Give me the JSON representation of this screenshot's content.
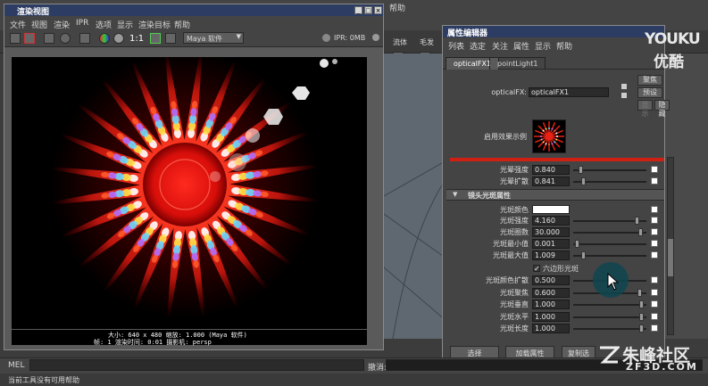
{
  "render_view": {
    "title": "渲染视图",
    "menu": [
      "文件",
      "视图",
      "渲染",
      "IPR",
      "选项",
      "显示",
      "渲染目标",
      "帮助"
    ],
    "renderer": "Maya 软件",
    "ratio_label": "1:1",
    "ipr_status": "IPR: 0MB",
    "info_line1": "大小: 640 x 480  缩放: 1.000          (Maya 软件)",
    "info_line2": "帧: 1       渲染时间: 0:01       摄影机: persp"
  },
  "maya": {
    "menu_help": "帮助",
    "shelf_tabs": [
      "流体",
      "毛发"
    ],
    "mel_label": "MEL",
    "cmd_output_label": "撤消:",
    "help_line": "当前工具没有可用帮助"
  },
  "attr_editor": {
    "title": "属性编辑器",
    "menu": [
      "列表",
      "选定",
      "关注",
      "属性",
      "显示",
      "帮助"
    ],
    "tabs": [
      "opticalFX1",
      "pointLight1"
    ],
    "node_label": "opticalFX:",
    "node_value": "opticalFX1",
    "focus_btn": "聚焦",
    "presets_btn": "预设",
    "show_btn": "显示",
    "hide_btn": "隐藏",
    "sample_label": "启用效果示例",
    "section_title": "镜头光斑属性",
    "hexagon_label": "六边形光斑",
    "rows_top": [
      {
        "label": "光晕强度",
        "value": "0.840",
        "pos": 0.08
      },
      {
        "label": "光晕扩散",
        "value": "0.841",
        "pos": 0.11
      }
    ],
    "flare_color_label": "光斑颜色",
    "rows_mid": [
      {
        "label": "光斑强度",
        "value": "4.160",
        "pos": 0.88
      },
      {
        "label": "光斑圈数",
        "value": "30.000",
        "pos": 0.93
      },
      {
        "label": "光斑最小值",
        "value": "0.001",
        "pos": 0.02
      },
      {
        "label": "光斑最大值",
        "value": "1.009",
        "pos": 0.12
      }
    ],
    "rows_bottom": [
      {
        "label": "光斑颜色扩散",
        "value": "0.500",
        "pos": 0.5
      },
      {
        "label": "光斑聚焦",
        "value": "0.600",
        "pos": 0.92
      },
      {
        "label": "光斑垂直",
        "value": "1.000",
        "pos": 0.95
      },
      {
        "label": "光斑水平",
        "value": "1.000",
        "pos": 0.95
      },
      {
        "label": "光斑长度",
        "value": "1.000",
        "pos": 0.95
      }
    ],
    "btn_select": "选择",
    "btn_load": "加载属性",
    "btn_copy": "复制选"
  },
  "watermarks": {
    "youku": "YOUKU",
    "youku_cn": "优酷",
    "zf_cn": "朱峰社区",
    "zf_url": "ZF3D.COM"
  },
  "colors": {
    "title_bar": "#2d3c62",
    "flare_red": "#e62214",
    "highlight": "#0f4550"
  }
}
